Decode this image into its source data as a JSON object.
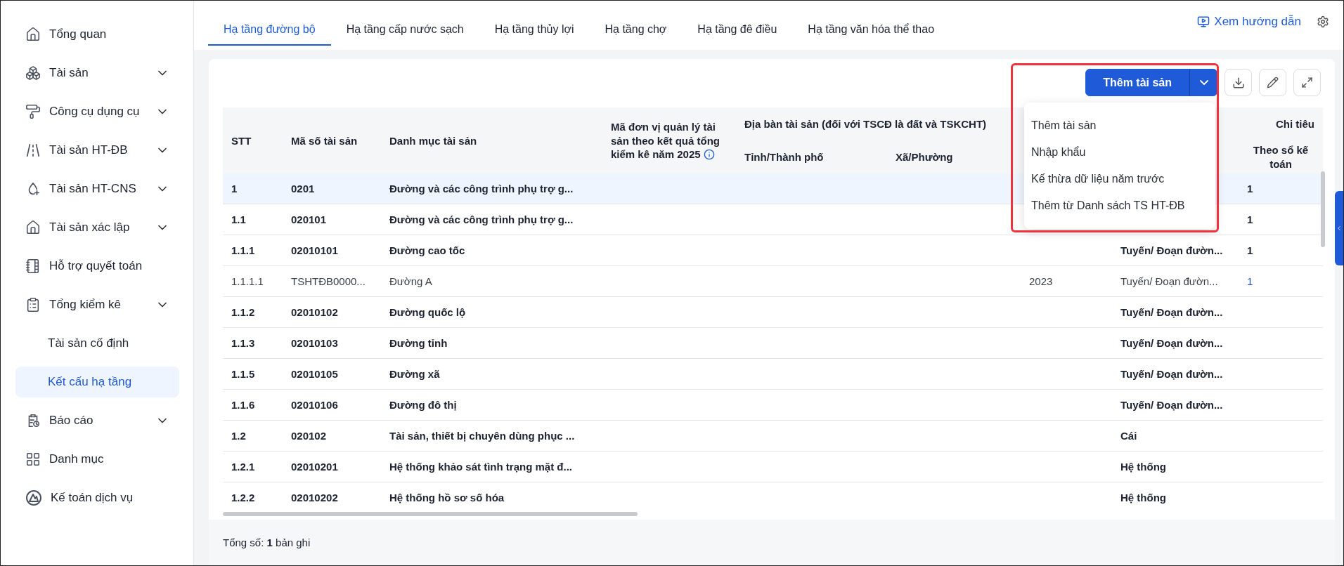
{
  "sidebar": {
    "items": [
      {
        "label": "Tổng quan",
        "has_submenu": false,
        "selected": false
      },
      {
        "label": "Tài sản",
        "has_submenu": true,
        "selected": false
      },
      {
        "label": "Công cụ dụng cụ",
        "has_submenu": true,
        "selected": false
      },
      {
        "label": "Tài sản HT-ĐB",
        "has_submenu": true,
        "selected": false
      },
      {
        "label": "Tài sản HT-CNS",
        "has_submenu": true,
        "selected": false
      },
      {
        "label": "Tài sản xác lập",
        "has_submenu": true,
        "selected": false
      },
      {
        "label": "Hỗ trợ quyết toán",
        "has_submenu": false,
        "selected": false
      },
      {
        "label": "Tổng kiểm kê",
        "has_submenu": true,
        "selected": false,
        "children": [
          {
            "label": "Tài sản cố định",
            "selected": false
          },
          {
            "label": "Kết cấu hạ tầng",
            "selected": true
          }
        ]
      },
      {
        "label": "Báo cáo",
        "has_submenu": true,
        "selected": false
      },
      {
        "label": "Danh mục",
        "has_submenu": false,
        "selected": false
      },
      {
        "label": "Kế toán dịch vụ",
        "has_submenu": false,
        "selected": false
      }
    ]
  },
  "tabs": [
    {
      "label": "Hạ tầng đường bộ",
      "selected": true
    },
    {
      "label": "Hạ tầng cấp nước sạch",
      "selected": false
    },
    {
      "label": "Hạ tầng thủy lợi",
      "selected": false
    },
    {
      "label": "Hạ tầng chợ",
      "selected": false
    },
    {
      "label": "Hạ tầng đê điều",
      "selected": false
    },
    {
      "label": "Hạ tầng văn hóa thể thao",
      "selected": false
    }
  ],
  "guide_link": "Xem hướng dẫn",
  "toolbar": {
    "add_button": "Thêm tài sản",
    "menu_open": true,
    "menu_items": [
      "Thêm tài sản",
      "Nhập khẩu",
      "Kế thừa dữ liệu năm trước",
      "Thêm từ Danh sách TS HT-ĐB"
    ]
  },
  "table": {
    "columns": {
      "stt": "STT",
      "code": "Mã số tài sản",
      "name": "Danh mục tài sản",
      "unit_code": "Mã đơn vị quản lý tài sản theo kết quả tổng kiểm kê năm 2025",
      "location_group": "Địa bàn tài sản (đối với TSCĐ là đất và TSKCHT)",
      "province": "Tỉnh/Thành phố",
      "ward": "Xã/Phường",
      "target_group": "Chi tiêu",
      "books": "Theo sổ kế toán"
    },
    "rows": [
      {
        "kind": "group",
        "selected": true,
        "stt": "1",
        "code": "0201",
        "name": "Đường và các công trình phụ trợ g...",
        "quantity": "1"
      },
      {
        "kind": "group",
        "selected": false,
        "stt": "1.1",
        "code": "020101",
        "name": "Đường và các công trình phụ trợ g...",
        "quantity": "1"
      },
      {
        "kind": "group",
        "selected": false,
        "stt": "1.1.1",
        "code": "02010101",
        "name": "Đường cao tốc",
        "unit": "Tuyến/ Đoạn đườn...",
        "quantity": "1"
      },
      {
        "kind": "item",
        "selected": false,
        "stt": "1.1.1.1",
        "code": "TSHTĐB0000...",
        "name": "Đường A",
        "year": "2023",
        "unit": "Tuyến/ Đoạn đườn...",
        "quantity": "1"
      },
      {
        "kind": "group",
        "selected": false,
        "stt": "1.1.2",
        "code": "02010102",
        "name": "Đường quốc lộ",
        "unit": "Tuyến/ Đoạn đườn..."
      },
      {
        "kind": "group",
        "selected": false,
        "stt": "1.1.3",
        "code": "02010103",
        "name": "Đường tỉnh",
        "unit": "Tuyến/ Đoạn đườn..."
      },
      {
        "kind": "group",
        "selected": false,
        "stt": "1.1.5",
        "code": "02010105",
        "name": "Đường xã",
        "unit": "Tuyến/ Đoạn đườn..."
      },
      {
        "kind": "group",
        "selected": false,
        "stt": "1.1.6",
        "code": "02010106",
        "name": "Đường đô thị",
        "unit": "Tuyến/ Đoạn đườn..."
      },
      {
        "kind": "group",
        "selected": false,
        "stt": "1.2",
        "code": "020102",
        "name": "Tài sản, thiết bị chuyên dùng phục ...",
        "unit": "Cái"
      },
      {
        "kind": "group",
        "selected": false,
        "stt": "1.2.1",
        "code": "02010201",
        "name": "Hệ thống khảo sát tình trạng mặt đ...",
        "unit": "Hệ thống"
      },
      {
        "kind": "group",
        "selected": false,
        "stt": "1.2.2",
        "code": "02010202",
        "name": "Hệ thống hồ sơ số hóa",
        "unit": "Hệ thống"
      }
    ]
  },
  "footer": "Tổng số: **1** bản ghi"
}
